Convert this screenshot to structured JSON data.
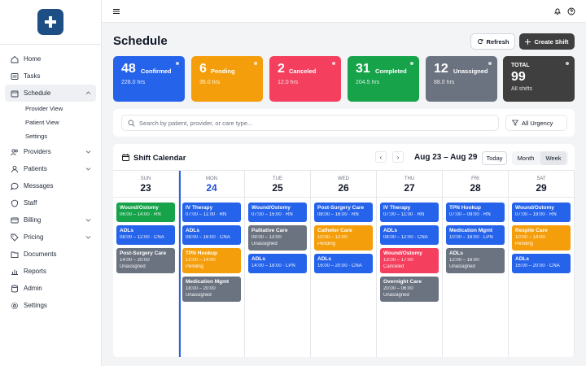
{
  "sidebar": {
    "logo": "plus-cross-logo",
    "items": [
      {
        "label": "Home",
        "icon": "home-icon"
      },
      {
        "label": "Tasks",
        "icon": "tasks-icon"
      },
      {
        "label": "Schedule",
        "icon": "calendar-icon",
        "active": true
      },
      {
        "label": "Providers",
        "icon": "users-icon"
      },
      {
        "label": "Patients",
        "icon": "user-icon"
      },
      {
        "label": "Messages",
        "icon": "message-icon"
      },
      {
        "label": "Staff",
        "icon": "staff-icon"
      },
      {
        "label": "Billing",
        "icon": "card-icon"
      },
      {
        "label": "Pricing",
        "icon": "tag-icon"
      },
      {
        "label": "Documents",
        "icon": "folder-icon"
      },
      {
        "label": "Reports",
        "icon": "chart-icon"
      },
      {
        "label": "Admin",
        "icon": "database-icon"
      },
      {
        "label": "Settings",
        "icon": "gear-icon"
      }
    ],
    "schedule_sub": [
      "Provider View",
      "Patient View",
      "Settings"
    ]
  },
  "header": {
    "title": "Schedule",
    "refresh_label": "Refresh",
    "create_label": "Create Shift"
  },
  "stats": [
    {
      "num": "48",
      "label": "Confirmed",
      "sub": "228.0 hrs",
      "color": "#2563eb"
    },
    {
      "num": "6",
      "label": "Pending",
      "sub": "36.0 hrs",
      "color": "#f59e0b"
    },
    {
      "num": "2",
      "label": "Canceled",
      "sub": "12.0 hrs",
      "color": "#f43f5e"
    },
    {
      "num": "31",
      "label": "Completed",
      "sub": "204.5 hrs",
      "color": "#16a34a"
    },
    {
      "num": "12",
      "label": "Unassigned",
      "sub": "88.0 hrs",
      "color": "#6b7280"
    }
  ],
  "total": {
    "label": "TOTAL",
    "num": "99",
    "sub": "All shifts",
    "color": "#3f3f3f"
  },
  "filters": {
    "search_placeholder": "Search by patient, provider, or care type...",
    "urgency_label": "All Urgency"
  },
  "calendar": {
    "title": "Shift Calendar",
    "range": "Aug 23 – Aug 29",
    "today_label": "Today",
    "month_label": "Month",
    "week_label": "Week",
    "days": [
      {
        "dn": "SUN",
        "dd": "23",
        "shifts": [
          {
            "t": "Wound/Ostomy",
            "d": "06:00 – 14:00 · RN",
            "c": "#16a34a"
          },
          {
            "t": "ADLs",
            "d": "08:00 – 12:00 · CNA",
            "c": "#2563eb"
          },
          {
            "t": "Post-Surgery Care",
            "d": "14:00 – 20:00",
            "d2": "Unassigned",
            "c": "#6b7280"
          }
        ]
      },
      {
        "dn": "MON",
        "dd": "24",
        "today": true,
        "shifts": [
          {
            "t": "IV Therapy",
            "d": "07:00 – 11:00 · RN",
            "c": "#2563eb"
          },
          {
            "t": "ADLs",
            "d": "08:00 – 16:00 · CNA",
            "c": "#2563eb"
          },
          {
            "t": "TPN Hookup",
            "d": "12:00 – 14:00",
            "d2": "Pending",
            "c": "#f59e0b"
          },
          {
            "t": "Medication Mgmt",
            "d": "18:00 – 20:00",
            "d2": "Unassigned",
            "c": "#6b7280"
          }
        ]
      },
      {
        "dn": "TUE",
        "dd": "25",
        "shifts": [
          {
            "t": "Wound/Ostomy",
            "d": "07:00 – 15:00 · RN",
            "c": "#2563eb"
          },
          {
            "t": "Palliative Care",
            "d": "09:00 – 13:00",
            "d2": "Unassigned",
            "c": "#6b7280"
          },
          {
            "t": "ADLs",
            "d": "14:00 – 18:00 · LPN",
            "c": "#2563eb"
          }
        ]
      },
      {
        "dn": "WED",
        "dd": "26",
        "shifts": [
          {
            "t": "Post-Surgery Care",
            "d": "08:00 – 16:00 · RN",
            "c": "#2563eb"
          },
          {
            "t": "Catheter Care",
            "d": "10:00 – 12:00",
            "d2": "Pending",
            "c": "#f59e0b"
          },
          {
            "t": "ADLs",
            "d": "16:00 – 20:00 · CNA",
            "c": "#2563eb"
          }
        ]
      },
      {
        "dn": "THU",
        "dd": "27",
        "shifts": [
          {
            "t": "IV Therapy",
            "d": "07:00 – 11:00 · RN",
            "c": "#2563eb"
          },
          {
            "t": "ADLs",
            "d": "08:00 – 12:00 · CNA",
            "c": "#2563eb"
          },
          {
            "t": "Wound/Ostomy",
            "d": "13:00 – 17:00",
            "d2": "Canceled",
            "c": "#f43f5e"
          },
          {
            "t": "Overnight Care",
            "d": "20:00 – 06:00",
            "d2": "Unassigned",
            "c": "#6b7280"
          }
        ]
      },
      {
        "dn": "FRI",
        "dd": "28",
        "shifts": [
          {
            "t": "TPN Hookup",
            "d": "07:00 – 09:00 · RN",
            "c": "#2563eb"
          },
          {
            "t": "Medication Mgmt",
            "d": "10:00 – 18:00 · LPN",
            "c": "#2563eb"
          },
          {
            "t": "ADLs",
            "d": "12:00 – 16:00",
            "d2": "Unassigned",
            "c": "#6b7280"
          }
        ]
      },
      {
        "dn": "SAT",
        "dd": "29",
        "shifts": [
          {
            "t": "Wound/Ostomy",
            "d": "07:00 – 19:00 · RN",
            "c": "#2563eb"
          },
          {
            "t": "Respite Care",
            "d": "10:00 – 14:00",
            "d2": "Pending",
            "c": "#f59e0b"
          },
          {
            "t": "ADLs",
            "d": "16:00 – 20:00 · CNA",
            "c": "#2563eb"
          }
        ]
      }
    ]
  }
}
